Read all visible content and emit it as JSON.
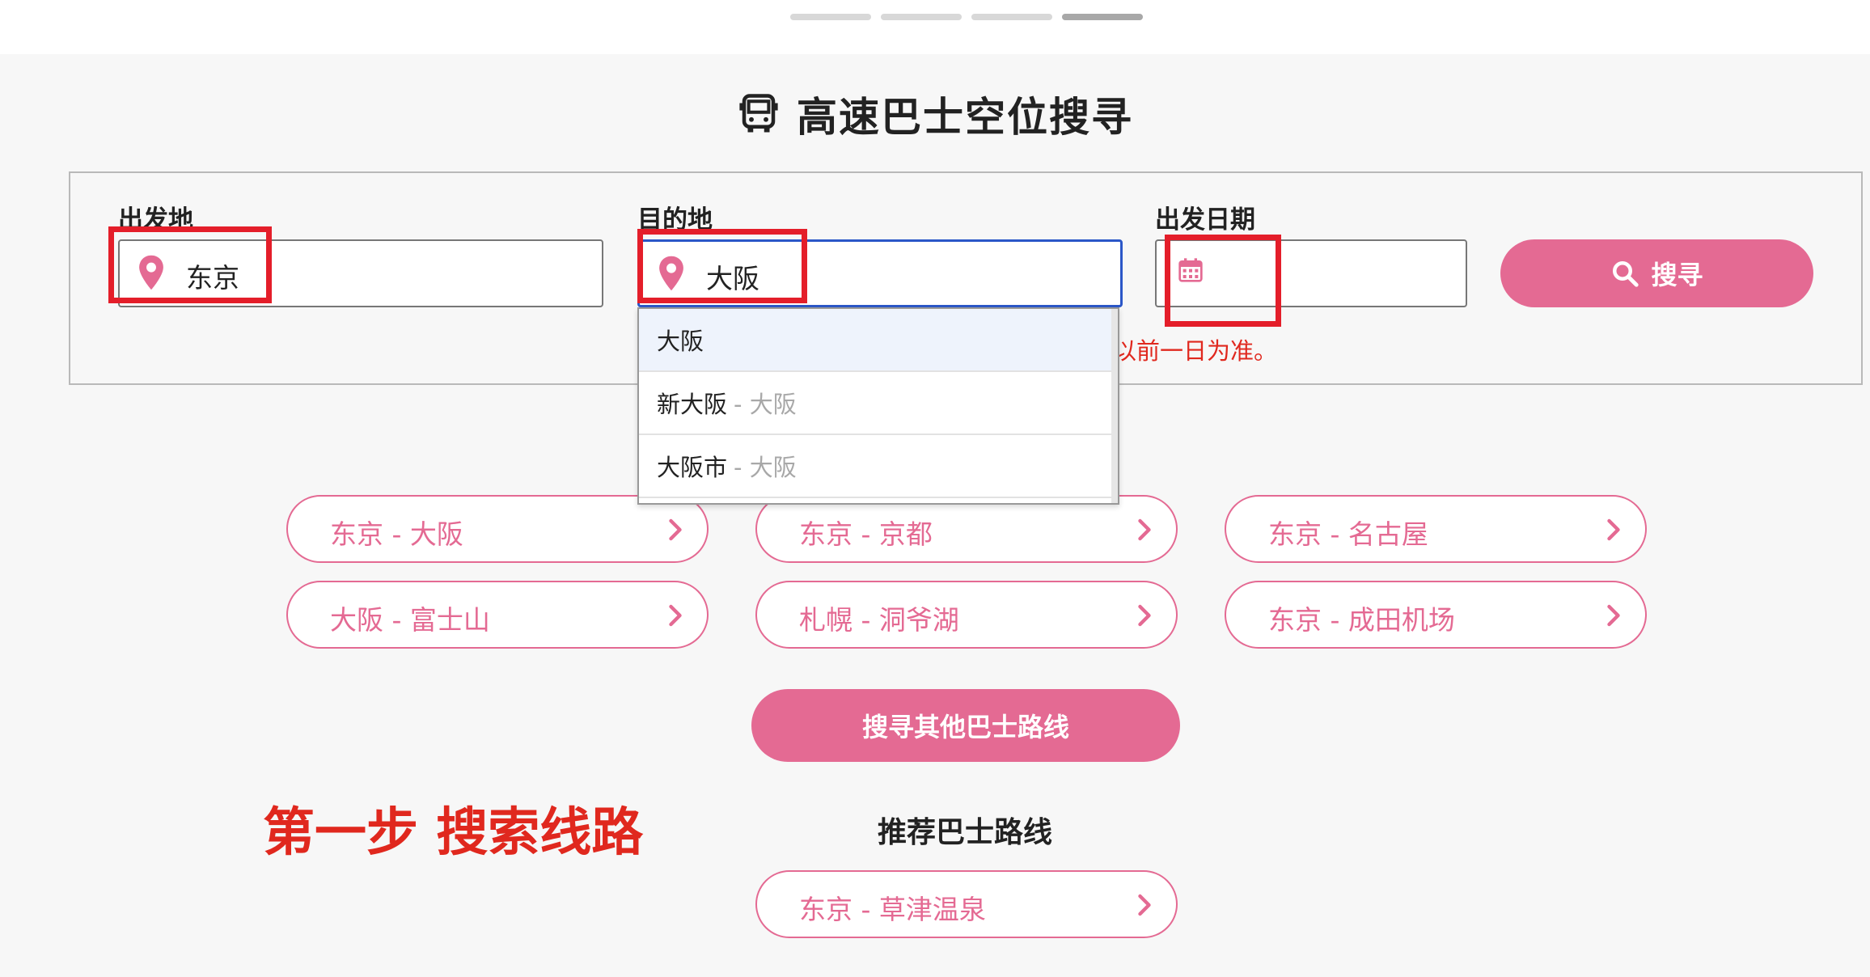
{
  "header": {
    "title": "高速巴士空位搜寻"
  },
  "form": {
    "departure": {
      "label": "出发地",
      "value": "东京"
    },
    "destination": {
      "label": "目的地",
      "value": "大阪"
    },
    "date": {
      "label": "出发日期",
      "value": ""
    },
    "search_label": "搜寻",
    "note": "以前一日为准。"
  },
  "dropdown": {
    "options": [
      {
        "name": "大阪",
        "sub": ""
      },
      {
        "name": "新大阪",
        "sub": "- 大阪"
      },
      {
        "name": "大阪市",
        "sub": "- 大阪"
      }
    ]
  },
  "routes": [
    {
      "label": "东京 - 大阪"
    },
    {
      "label": "东京 - 京都"
    },
    {
      "label": "东京 - 名古屋"
    },
    {
      "label": "大阪 - 富士山"
    },
    {
      "label": "札幌 - 洞爷湖"
    },
    {
      "label": "东京 - 成田机场"
    }
  ],
  "more_routes_label": "搜寻其他巴士路线",
  "annotation": {
    "step_text": "第一步 搜索线路"
  },
  "recommended": {
    "title": "推荐巴士路线",
    "routes": [
      {
        "label": "东京 - 草津温泉"
      }
    ]
  },
  "icons": {
    "title_icon": "bus-icon",
    "field_icon": "map-pin-icon",
    "date_icon": "calendar-icon",
    "search_icon": "search-icon",
    "route_icon": "chevron-right-icon"
  },
  "colors": {
    "accent": "#e46a93",
    "annotation_red": "#e41e2a",
    "focus_border": "#2b57c8",
    "note_red": "#e0281e"
  }
}
